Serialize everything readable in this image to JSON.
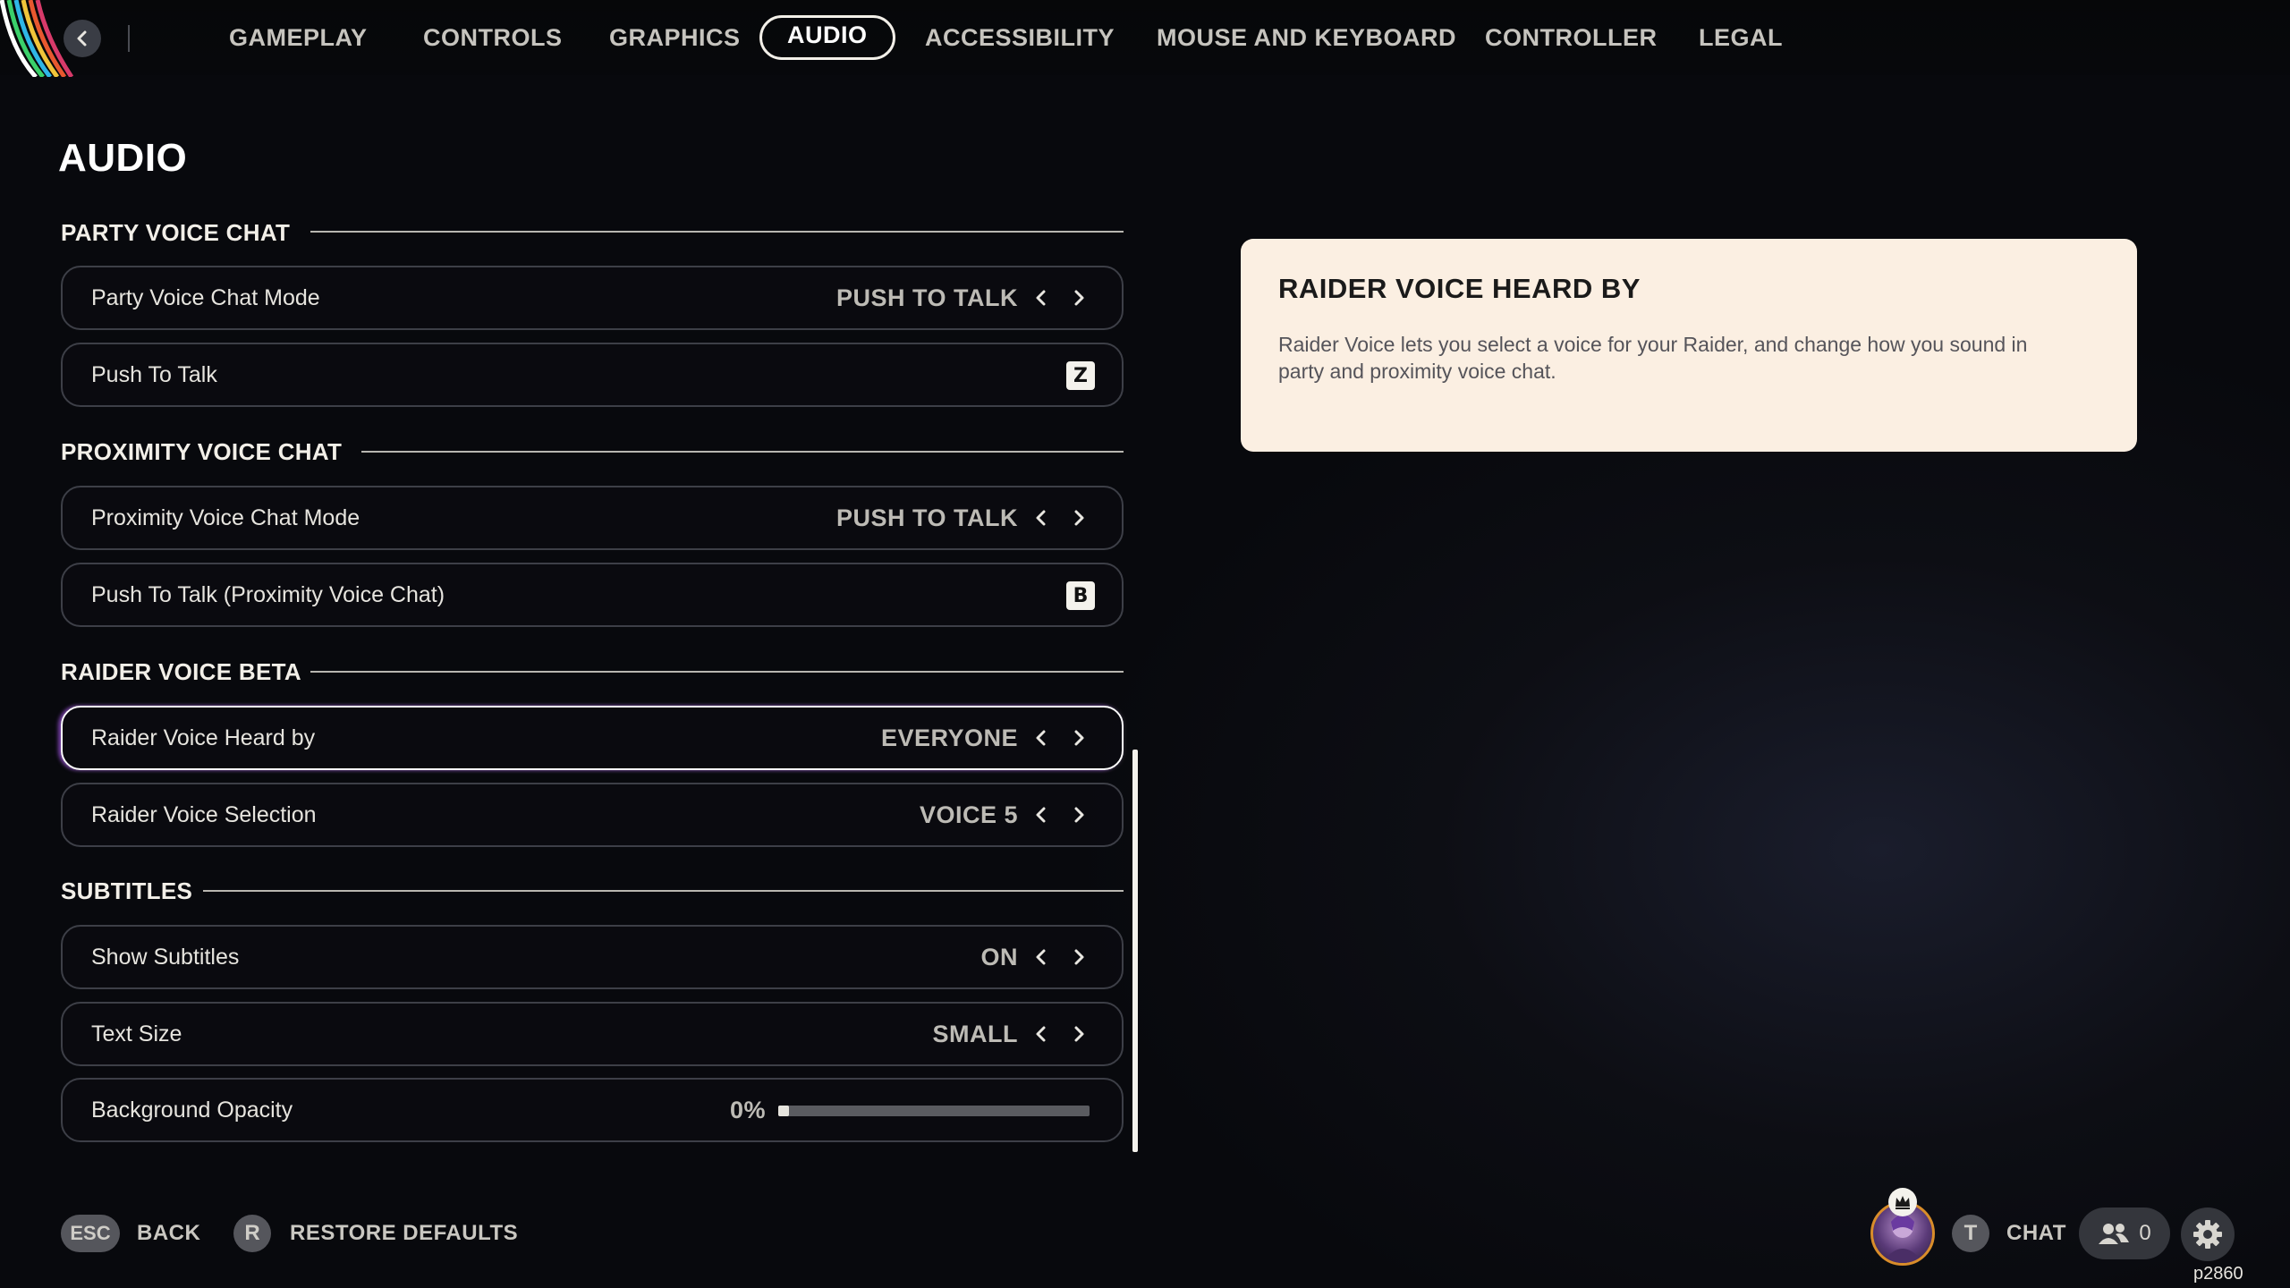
{
  "nav": {
    "tabs": [
      {
        "label": "GAMEPLAY"
      },
      {
        "label": "CONTROLS"
      },
      {
        "label": "GRAPHICS"
      },
      {
        "label": "AUDIO"
      },
      {
        "label": "ACCESSIBILITY"
      },
      {
        "label": "MOUSE AND KEYBOARD"
      },
      {
        "label": "CONTROLLER"
      },
      {
        "label": "LEGAL"
      }
    ],
    "active_tab": "AUDIO"
  },
  "page": {
    "title": "AUDIO"
  },
  "sections": {
    "party": {
      "heading": "PARTY VOICE CHAT",
      "mode": {
        "label": "Party Voice Chat Mode",
        "value": "PUSH TO TALK"
      },
      "ptt": {
        "label": "Push To Talk",
        "key": "Z"
      }
    },
    "proximity": {
      "heading": "PROXIMITY VOICE CHAT",
      "mode": {
        "label": "Proximity Voice Chat Mode",
        "value": "PUSH TO TALK"
      },
      "ptt": {
        "label": "Push To Talk (Proximity Voice Chat)",
        "key": "B"
      }
    },
    "raider": {
      "heading": "RAIDER VOICE BETA",
      "heard_by": {
        "label": "Raider Voice Heard by",
        "value": "EVERYONE"
      },
      "selection": {
        "label": "Raider Voice Selection",
        "value": "VOICE 5"
      }
    },
    "subtitles": {
      "heading": "SUBTITLES",
      "show": {
        "label": "Show Subtitles",
        "value": "ON"
      },
      "text_size": {
        "label": "Text Size",
        "value": "SMALL"
      },
      "bg_opacity": {
        "label": "Background Opacity",
        "value": "0%",
        "level": 0
      }
    }
  },
  "info_panel": {
    "title": "RAIDER VOICE HEARD BY",
    "description": "Raider Voice lets you select a voice for your Raider, and change how you sound in party and proximity voice chat."
  },
  "footer": {
    "back": {
      "key": "ESC",
      "label": "BACK"
    },
    "restore": {
      "key": "R",
      "label": "RESTORE DEFAULTS"
    },
    "chat": {
      "key": "T",
      "label": "CHAT"
    },
    "friends_count": "0",
    "build_id": "p2860"
  },
  "colors": {
    "background": "#0b0c11",
    "panel": "#fbefe2",
    "accent_border": "#f2efe8",
    "row_border": "#3d3f47"
  },
  "icons": [
    "back-arrow-icon",
    "chevron-left-icon",
    "chevron-right-icon",
    "crown-icon",
    "friends-icon",
    "gear-icon"
  ]
}
